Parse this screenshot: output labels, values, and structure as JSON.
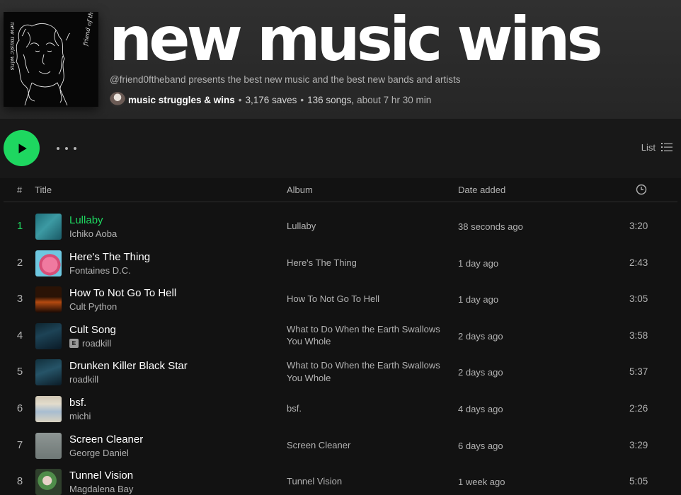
{
  "playlist": {
    "title": "new music wins",
    "description": "@friend0ftheband presents the best new music and the best new bands and artists",
    "owner": "music struggles & wins",
    "saves": "3,176 saves",
    "songs": "136 songs,",
    "duration": "about 7 hr 30 min",
    "cover_text": [
      "new music wins",
      "friend of the band"
    ]
  },
  "controls": {
    "play_icon": "play-icon",
    "more_icon": "more-options-icon",
    "view_label": "List",
    "view_icon": "list-view-icon"
  },
  "columns": {
    "num": "#",
    "title": "Title",
    "album": "Album",
    "date": "Date added",
    "duration_icon": "clock-icon"
  },
  "tracks": [
    {
      "num": "1",
      "title": "Lullaby",
      "artist": "Ichiko Aoba",
      "explicit": false,
      "album": "Lullaby",
      "date": "38 seconds ago",
      "duration": "3:20",
      "playing": true
    },
    {
      "num": "2",
      "title": "Here's The Thing",
      "artist": "Fontaines D.C.",
      "explicit": false,
      "album": "Here's The Thing",
      "date": "1 day ago",
      "duration": "2:43"
    },
    {
      "num": "3",
      "title": "How To Not Go To Hell",
      "artist": "Cult Python",
      "explicit": false,
      "album": "How To Not Go To Hell",
      "date": "1 day ago",
      "duration": "3:05"
    },
    {
      "num": "4",
      "title": "Cult Song",
      "artist": "roadkill",
      "explicit": true,
      "explicit_label": "E",
      "album": "What to Do When the Earth Swallows You Whole",
      "date": "2 days ago",
      "duration": "3:58"
    },
    {
      "num": "5",
      "title": "Drunken Killer Black Star",
      "artist": "roadkill",
      "explicit": false,
      "album": "What to Do When the Earth Swallows You Whole",
      "date": "2 days ago",
      "duration": "5:37"
    },
    {
      "num": "6",
      "title": "bsf.",
      "artist": "michi",
      "explicit": false,
      "album": "bsf.",
      "date": "4 days ago",
      "duration": "2:26"
    },
    {
      "num": "7",
      "title": "Screen Cleaner",
      "artist": "George Daniel",
      "explicit": false,
      "album": "Screen Cleaner",
      "date": "6 days ago",
      "duration": "3:29"
    },
    {
      "num": "8",
      "title": "Tunnel Vision",
      "artist": "Magdalena Bay",
      "explicit": false,
      "album": "Tunnel Vision",
      "date": "1 week ago",
      "duration": "5:05"
    }
  ],
  "colors": {
    "accent": "#1ed760",
    "background": "#121212",
    "header": "#2b2b2b",
    "text_muted": "#b3b3b3"
  }
}
